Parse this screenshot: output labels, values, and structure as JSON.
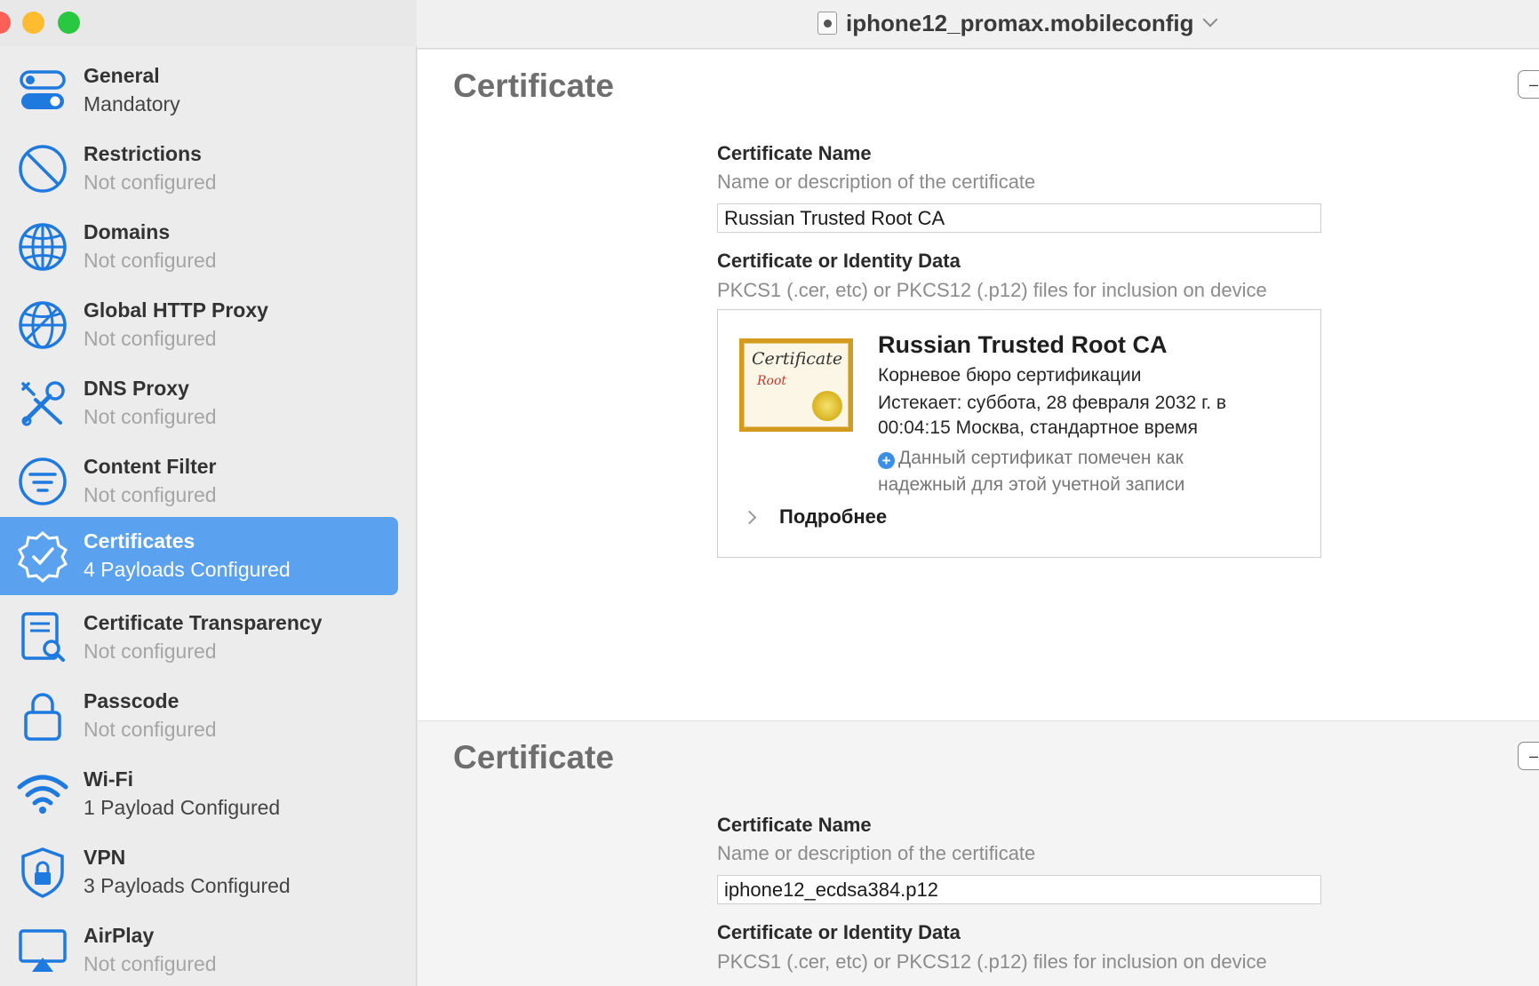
{
  "window": {
    "title": "iphone12_promax.mobileconfig"
  },
  "sidebar": {
    "items": [
      {
        "title": "General",
        "subtitle": "Mandatory",
        "icon": "toggle-icon"
      },
      {
        "title": "Restrictions",
        "subtitle": "Not configured",
        "icon": "prohibited-icon"
      },
      {
        "title": "Domains",
        "subtitle": "Not configured",
        "icon": "globe-icon"
      },
      {
        "title": "Global HTTP Proxy",
        "subtitle": "Not configured",
        "icon": "globe-network-icon"
      },
      {
        "title": "DNS Proxy",
        "subtitle": "Not configured",
        "icon": "tools-icon"
      },
      {
        "title": "Content Filter",
        "subtitle": "Not configured",
        "icon": "filter-icon"
      },
      {
        "title": "Certificates",
        "subtitle": "4 Payloads Configured",
        "icon": "certificate-badge-icon",
        "active": true
      },
      {
        "title": "Certificate Transparency",
        "subtitle": "Not configured",
        "icon": "document-search-icon"
      },
      {
        "title": "Passcode",
        "subtitle": "Not configured",
        "icon": "lock-icon"
      },
      {
        "title": "Wi-Fi",
        "subtitle": "1 Payload Configured",
        "icon": "wifi-icon"
      },
      {
        "title": "VPN",
        "subtitle": "3 Payloads Configured",
        "icon": "vpn-shield-icon"
      },
      {
        "title": "AirPlay",
        "subtitle": "Not configured",
        "icon": "airplay-icon"
      }
    ]
  },
  "sections": [
    {
      "title": "Certificate",
      "remove_label": "–",
      "name_label": "Certificate Name",
      "name_hint": "Name or description of the certificate",
      "name_value": "Russian Trusted Root CA",
      "data_label": "Certificate or Identity Data",
      "data_hint": "PKCS1 (.cer, etc) or PKCS12 (.p12) files for inclusion on device",
      "cert": {
        "image_text_1": "Certificate",
        "image_text_2": "Root",
        "title": "Russian Trusted Root CA",
        "issuer": "Корневое бюро сертификации",
        "expires_line_1": "Истекает: суббота, 28 февраля 2032 г. в",
        "expires_line_2": "00:04:15 Москва, стандартное время",
        "trust_line_1": "Данный сертификат помечен как",
        "trust_line_2": "надежный для этой учетной записи",
        "details_label": "Подробнее"
      }
    },
    {
      "title": "Certificate",
      "remove_label": "–",
      "name_label": "Certificate Name",
      "name_hint": "Name or description of the certificate",
      "name_value": "iphone12_ecdsa384.p12",
      "data_label": "Certificate or Identity Data",
      "data_hint": "PKCS1 (.cer, etc) or PKCS12 (.p12) files for inclusion on device"
    }
  ],
  "colors": {
    "accent": "#5aa2f0",
    "icon_blue": "#1f7ae0"
  }
}
